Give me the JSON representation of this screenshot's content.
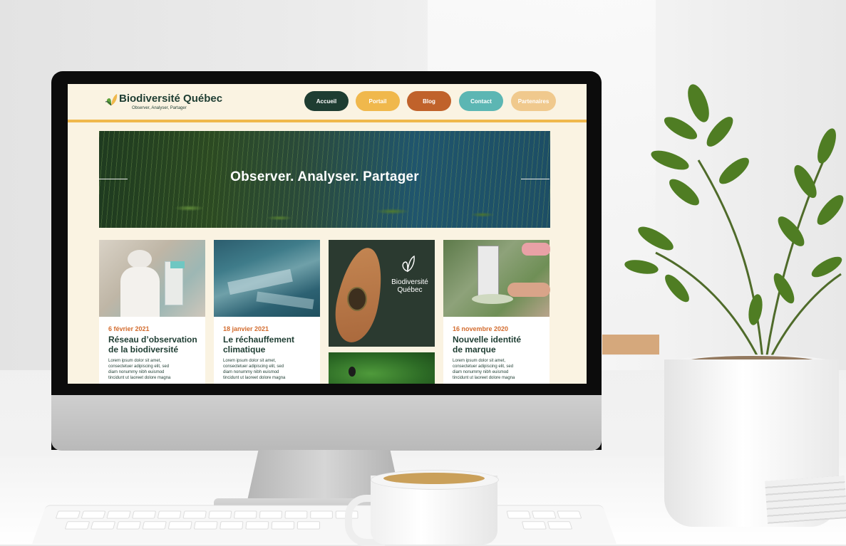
{
  "site": {
    "name": "Biodiversité Québec",
    "tagline": "Observer, Analyser, Partager",
    "colors": {
      "green": "#1e3d32",
      "yellow": "#f0b84c",
      "orange": "#c0622b",
      "teal": "#5cb6b3",
      "peach": "#f0c98d",
      "cream": "#faf3e2"
    }
  },
  "nav": [
    {
      "label": "Accueil",
      "color": "#1e3d32"
    },
    {
      "label": "Portail",
      "color": "#f0b84c"
    },
    {
      "label": "Blog",
      "color": "#c0622b"
    },
    {
      "label": "Contact",
      "color": "#5cb6b3"
    },
    {
      "label": "Partenaires",
      "color": "#f0c98d"
    }
  ],
  "hero": {
    "title": "Observer. Analyser. Partager"
  },
  "cards": [
    {
      "date": "6 février 2021",
      "title_1": "Réseau d’observation",
      "title_2": "de la biodiversité",
      "body_1": "Lorem ipsum dolor sit amet,",
      "body_2": "consectetuer adipiscing elit, sed",
      "body_3": "diam nonummy nibh euismod",
      "body_4": "tincidunt ut laoreet dolore magna"
    },
    {
      "date": "18 janvier 2021",
      "title_1": "Le réchauffement",
      "title_2": "climatique",
      "body_1": "Lorem ipsum dolor sit amet,",
      "body_2": "consectetuer adipiscing elit, sed",
      "body_3": "diam nonummy nibh euismod",
      "body_4": "tincidunt ut laoreet dolore magna"
    },
    {
      "logo_1": "Biodiversité",
      "logo_2": "Québec"
    },
    {
      "date": "16 novembre 2020",
      "title_1": "Nouvelle identité",
      "title_2": "de marque",
      "body_1": "Lorem ipsum dolor sit amet,",
      "body_2": "consectetuer adipiscing elit, sed",
      "body_3": "diam nonummy nibh euismod",
      "body_4": "tincidunt ut laoreet dolore magna"
    }
  ]
}
